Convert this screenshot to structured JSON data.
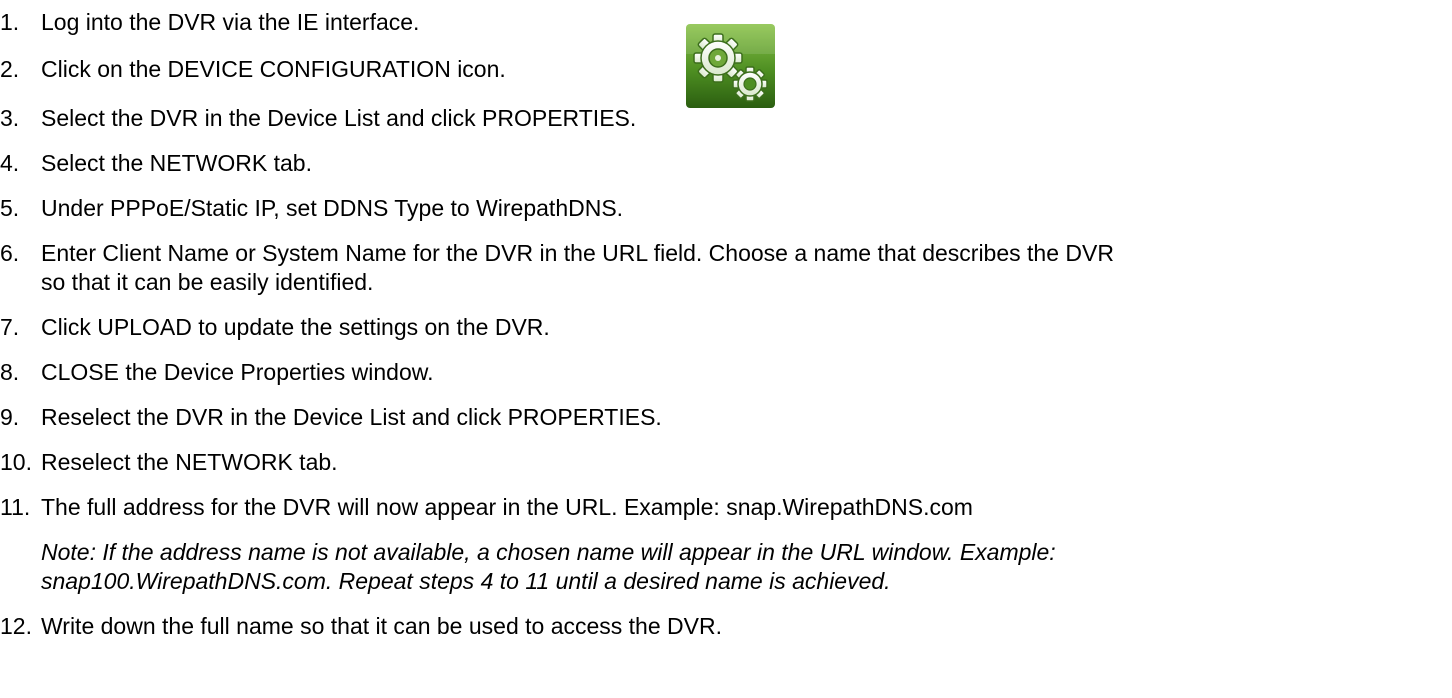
{
  "steps": [
    {
      "num": "1.",
      "text": "Log into the DVR via the IE interface."
    },
    {
      "num": "2.",
      "text": "Click on the DEVICE CONFIGURATION icon."
    },
    {
      "num": "3.",
      "text": "Select the DVR in the Device List and click PROPERTIES."
    },
    {
      "num": "4.",
      "text": "Select the NETWORK tab."
    },
    {
      "num": "5.",
      "text": "Under PPPoE/Static IP, set DDNS Type to WirepathDNS."
    },
    {
      "num": "6.",
      "text": "Enter Client Name or System Name for the DVR in the URL field.  Choose a name that describes the DVR",
      "text2": "so that it can be easily identified."
    },
    {
      "num": "7.",
      "text": "Click UPLOAD to update the settings on the DVR."
    },
    {
      "num": "8.",
      "text": "CLOSE the Device Properties window."
    },
    {
      "num": "9.",
      "text": "Reselect the DVR in the Device List and click PROPERTIES."
    },
    {
      "num": "10.",
      "text": "Reselect the NETWORK tab."
    },
    {
      "num": "11.",
      "text": "The full address for the DVR will now appear in the URL.  Example: snap.WirepathDNS.com"
    },
    {
      "num": "12.",
      "text": "Write down the full name so that it can be used to access the DVR."
    }
  ],
  "note": {
    "line1": "Note: If the address name is not available, a chosen name will appear in the URL window.  Example:",
    "line2": "snap100.WirepathDNS.com.  Repeat steps 4 to 11 until a desired name is achieved."
  },
  "icon": {
    "name": "device-configuration-gears",
    "bg_top": "#7cb342",
    "bg_bottom": "#2e6b12",
    "gear_color": "#f2f7ec"
  }
}
